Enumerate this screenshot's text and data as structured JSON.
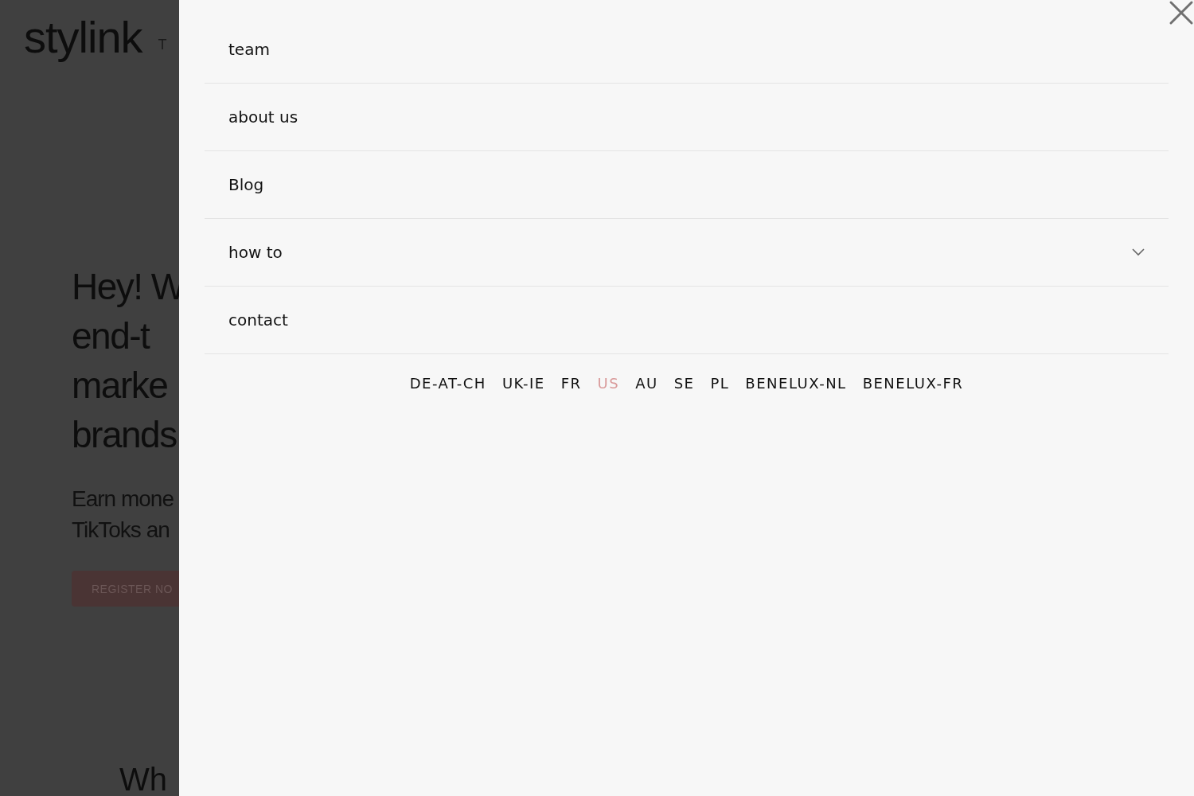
{
  "background_page": {
    "logo": "stylink",
    "nav_fragment": "T",
    "headline": [
      "Hey! W",
      "end-t",
      "marke",
      "brands"
    ],
    "subtitle": [
      "Earn mone",
      "TikToks an"
    ],
    "cta_button": "REGISTER NO",
    "section_heading": "Wh"
  },
  "menu": {
    "items": [
      {
        "label": "team",
        "expandable": false
      },
      {
        "label": "about us",
        "expandable": false
      },
      {
        "label": "Blog",
        "expandable": false
      },
      {
        "label": "how to",
        "expandable": true
      },
      {
        "label": "contact",
        "expandable": false
      }
    ],
    "languages": [
      {
        "label": "DE-AT-CH",
        "selected": false
      },
      {
        "label": "UK-IE",
        "selected": false
      },
      {
        "label": "FR",
        "selected": false
      },
      {
        "label": "US",
        "selected": true
      },
      {
        "label": "AU",
        "selected": false
      },
      {
        "label": "SE",
        "selected": false
      },
      {
        "label": "PL",
        "selected": false
      },
      {
        "label": "BENELUX-NL",
        "selected": false
      },
      {
        "label": "BENELUX-FR",
        "selected": false
      }
    ]
  }
}
